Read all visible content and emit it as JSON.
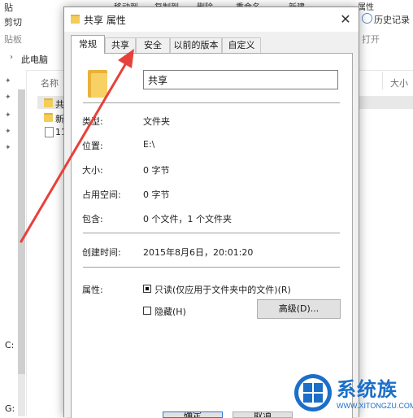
{
  "explorer": {
    "ribbon": {
      "paste": "贴",
      "cut": "剪切",
      "clipboard": "贴板",
      "move_to": "移动到",
      "copy_to": "复制到",
      "delete": "删除",
      "rename": "重命名",
      "new": "新建",
      "properties": "属性",
      "history": "历史记录",
      "open": "打开"
    },
    "address": {
      "path": "此电脑"
    },
    "columns": {
      "name": "名称",
      "size": "大小"
    },
    "files": [
      {
        "name": "共"
      },
      {
        "name": "新"
      },
      {
        "name": "11"
      }
    ],
    "drives": [
      "C:",
      "G:"
    ]
  },
  "dialog": {
    "title": "共享 属性",
    "tabs": [
      {
        "label": "常规",
        "active": true
      },
      {
        "label": "共享"
      },
      {
        "label": "安全"
      },
      {
        "label": "以前的版本"
      },
      {
        "label": "自定义"
      }
    ],
    "folder_name": "共享",
    "props": {
      "type_label": "类型:",
      "type_value": "文件夹",
      "location_label": "位置:",
      "location_value": "E:\\",
      "size_label": "大小:",
      "size_value": "0 字节",
      "size_on_disk_label": "占用空间:",
      "size_on_disk_value": "0 字节",
      "contains_label": "包含:",
      "contains_value": "0 个文件，1 个文件夹",
      "created_label": "创建时间:",
      "created_value": "2015年8月6日，20:01:20",
      "attributes_label": "属性:",
      "readonly_label": "只读(仅应用于文件夹中的文件)(R)",
      "readonly_checked": true,
      "hidden_label": "隐藏(H)",
      "hidden_checked": false,
      "advanced_button": "高级(D)..."
    },
    "footer": {
      "ok": "确定",
      "cancel": "取消"
    }
  },
  "watermark": {
    "brand": "系统族",
    "url": "WWW.XITONGZU.COM"
  },
  "colors": {
    "arrow": "#e8403a",
    "accent": "#1b6fc9",
    "folder": "#f3cc5a"
  }
}
